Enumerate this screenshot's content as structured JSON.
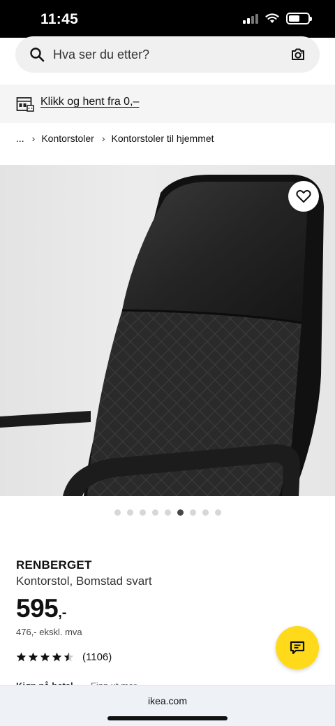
{
  "status_bar": {
    "time": "11:45"
  },
  "search": {
    "placeholder": "Hva ser du etter?"
  },
  "pickup": {
    "label": "Klikk og hent fra 0,–"
  },
  "breadcrumb": {
    "items": [
      "...",
      "Kontorstoler",
      "Kontorstoler til hjemmet"
    ]
  },
  "gallery": {
    "total_images": 9,
    "active_index": 5
  },
  "product": {
    "name": "RENBERGET",
    "description": "Kontorstol, Bomstad svart",
    "price": "595",
    "price_suffix": ",-",
    "price_excl_vat": "476,- ekskl. mva",
    "rating": 4.5,
    "review_count": "(1106)"
  },
  "cut_text": {
    "bold": "Kjøp på hetel......",
    "rest": " Finn ut mer"
  },
  "browser": {
    "url": "ikea.com"
  },
  "colors": {
    "chat_button": "#ffda1a",
    "banner_bg": "#f5f5f5",
    "search_bg": "#f0f0f0"
  },
  "icons": [
    "search-icon",
    "camera-icon",
    "store-icon",
    "chevron-right-icon",
    "heart-icon",
    "star-icon",
    "chat-icon"
  ]
}
